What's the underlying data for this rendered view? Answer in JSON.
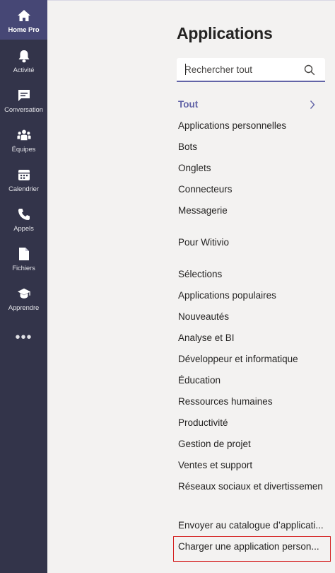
{
  "rail": {
    "items": [
      {
        "label": "Home Pro",
        "icon": "home-icon"
      },
      {
        "label": "Activité",
        "icon": "bell-icon"
      },
      {
        "label": "Conversation",
        "icon": "chat-icon"
      },
      {
        "label": "Équipes",
        "icon": "teams-icon"
      },
      {
        "label": "Calendrier",
        "icon": "calendar-icon"
      },
      {
        "label": "Appels",
        "icon": "phone-icon"
      },
      {
        "label": "Fichiers",
        "icon": "file-icon"
      },
      {
        "label": "Apprendre",
        "icon": "graduation-cap-icon"
      }
    ],
    "more": "•••"
  },
  "page": {
    "title": "Applications",
    "search_placeholder": "Rechercher tout"
  },
  "nav": {
    "all": "Tout",
    "group1": [
      "Applications personnelles",
      "Bots",
      "Onglets",
      "Connecteurs",
      "Messagerie"
    ],
    "group2": [
      "Pour Witivio"
    ],
    "group3": [
      "Sélections",
      "Applications populaires",
      "Nouveautés",
      "Analyse et BI",
      "Développeur et informatique",
      "Éducation",
      "Ressources humaines",
      "Productivité",
      "Gestion de projet",
      "Ventes et support",
      "Réseaux sociaux et divertissemen"
    ],
    "submit": "Envoyer au catalogue d’applicati...",
    "upload": "Charger une application person..."
  },
  "colors": {
    "rail_bg": "#33344a",
    "rail_active": "#464775",
    "accent": "#6264a7",
    "highlight_box": "#d42020"
  }
}
